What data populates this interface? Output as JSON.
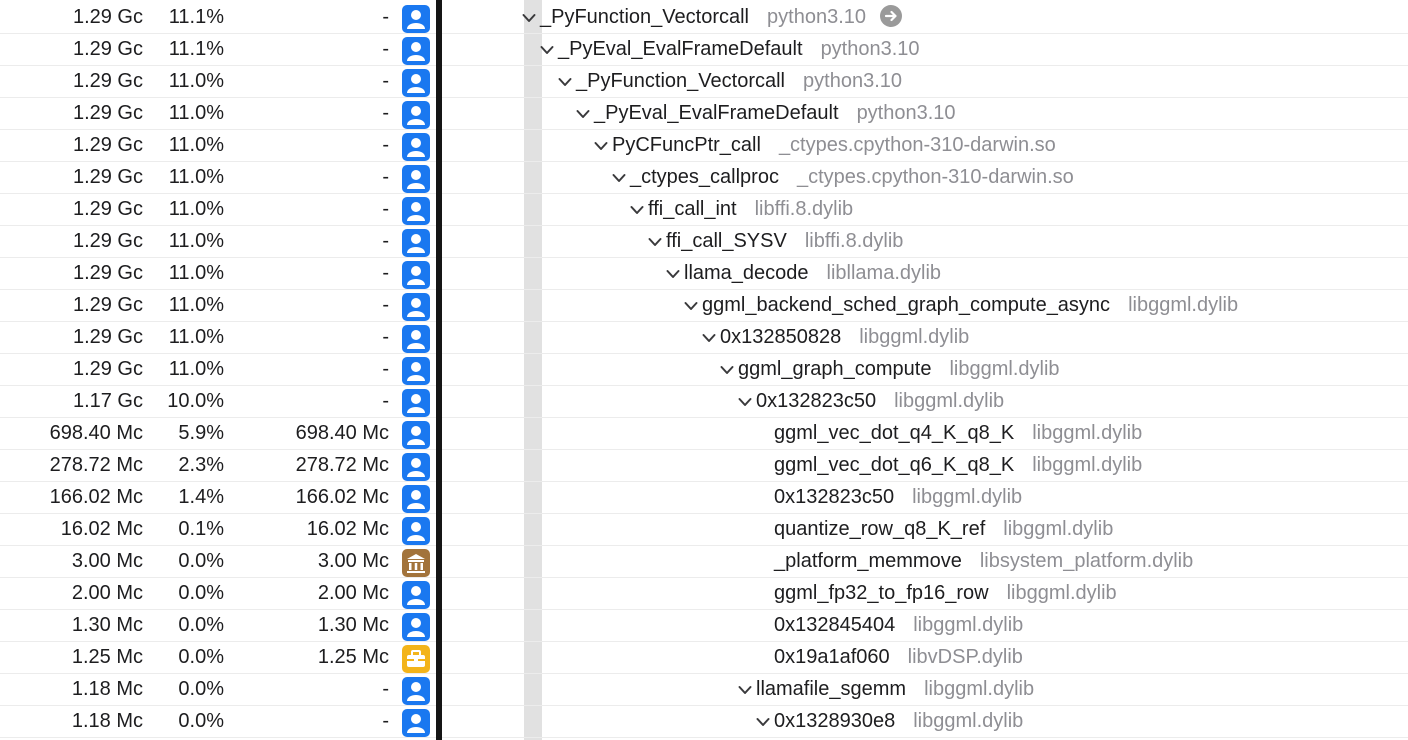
{
  "left_rows": [
    {
      "weight": "1.29 Gc",
      "percent": "11.1%",
      "self": "-",
      "icon": "user-icon"
    },
    {
      "weight": "1.29 Gc",
      "percent": "11.1%",
      "self": "-",
      "icon": "user-icon"
    },
    {
      "weight": "1.29 Gc",
      "percent": "11.0%",
      "self": "-",
      "icon": "user-icon"
    },
    {
      "weight": "1.29 Gc",
      "percent": "11.0%",
      "self": "-",
      "icon": "user-icon"
    },
    {
      "weight": "1.29 Gc",
      "percent": "11.0%",
      "self": "-",
      "icon": "user-icon"
    },
    {
      "weight": "1.29 Gc",
      "percent": "11.0%",
      "self": "-",
      "icon": "user-icon"
    },
    {
      "weight": "1.29 Gc",
      "percent": "11.0%",
      "self": "-",
      "icon": "user-icon"
    },
    {
      "weight": "1.29 Gc",
      "percent": "11.0%",
      "self": "-",
      "icon": "user-icon"
    },
    {
      "weight": "1.29 Gc",
      "percent": "11.0%",
      "self": "-",
      "icon": "user-icon"
    },
    {
      "weight": "1.29 Gc",
      "percent": "11.0%",
      "self": "-",
      "icon": "user-icon"
    },
    {
      "weight": "1.29 Gc",
      "percent": "11.0%",
      "self": "-",
      "icon": "user-icon"
    },
    {
      "weight": "1.29 Gc",
      "percent": "11.0%",
      "self": "-",
      "icon": "user-icon"
    },
    {
      "weight": "1.17 Gc",
      "percent": "10.0%",
      "self": "-",
      "icon": "user-icon"
    },
    {
      "weight": "698.40 Mc",
      "percent": "5.9%",
      "self": "698.40 Mc",
      "icon": "user-icon"
    },
    {
      "weight": "278.72 Mc",
      "percent": "2.3%",
      "self": "278.72 Mc",
      "icon": "user-icon"
    },
    {
      "weight": "166.02 Mc",
      "percent": "1.4%",
      "self": "166.02 Mc",
      "icon": "user-icon"
    },
    {
      "weight": "16.02 Mc",
      "percent": "0.1%",
      "self": "16.02 Mc",
      "icon": "user-icon"
    },
    {
      "weight": "3.00 Mc",
      "percent": "0.0%",
      "self": "3.00 Mc",
      "icon": "library-icon"
    },
    {
      "weight": "2.00 Mc",
      "percent": "0.0%",
      "self": "2.00 Mc",
      "icon": "user-icon"
    },
    {
      "weight": "1.30 Mc",
      "percent": "0.0%",
      "self": "1.30 Mc",
      "icon": "user-icon"
    },
    {
      "weight": "1.25 Mc",
      "percent": "0.0%",
      "self": "1.25 Mc",
      "icon": "toolbox-icon"
    },
    {
      "weight": "1.18 Mc",
      "percent": "0.0%",
      "self": "-",
      "icon": "user-icon"
    },
    {
      "weight": "1.18 Mc",
      "percent": "0.0%",
      "self": "-",
      "icon": "user-icon"
    }
  ],
  "tree_rows": [
    {
      "symbol": "_PyFunction_Vectorcall",
      "library": "python3.10",
      "expanded": true,
      "depth": 0,
      "focus_button": true
    },
    {
      "symbol": "_PyEval_EvalFrameDefault",
      "library": "python3.10",
      "expanded": true,
      "depth": 1
    },
    {
      "symbol": "_PyFunction_Vectorcall",
      "library": "python3.10",
      "expanded": true,
      "depth": 2
    },
    {
      "symbol": "_PyEval_EvalFrameDefault",
      "library": "python3.10",
      "expanded": true,
      "depth": 3
    },
    {
      "symbol": "PyCFuncPtr_call",
      "library": "_ctypes.cpython-310-darwin.so",
      "expanded": true,
      "depth": 4
    },
    {
      "symbol": "_ctypes_callproc",
      "library": "_ctypes.cpython-310-darwin.so",
      "expanded": true,
      "depth": 5
    },
    {
      "symbol": "ffi_call_int",
      "library": "libffi.8.dylib",
      "expanded": true,
      "depth": 6
    },
    {
      "symbol": "ffi_call_SYSV",
      "library": "libffi.8.dylib",
      "expanded": true,
      "depth": 7
    },
    {
      "symbol": "llama_decode",
      "library": "libllama.dylib",
      "expanded": true,
      "depth": 8
    },
    {
      "symbol": "ggml_backend_sched_graph_compute_async",
      "library": "libggml.dylib",
      "expanded": true,
      "depth": 9
    },
    {
      "symbol": "0x132850828",
      "library": "libggml.dylib",
      "expanded": true,
      "depth": 10
    },
    {
      "symbol": "ggml_graph_compute",
      "library": "libggml.dylib",
      "expanded": true,
      "depth": 11
    },
    {
      "symbol": "0x132823c50",
      "library": "libggml.dylib",
      "expanded": true,
      "depth": 12
    },
    {
      "symbol": "ggml_vec_dot_q4_K_q8_K",
      "library": "libggml.dylib",
      "expanded": false,
      "depth": 13
    },
    {
      "symbol": "ggml_vec_dot_q6_K_q8_K",
      "library": "libggml.dylib",
      "expanded": false,
      "depth": 13
    },
    {
      "symbol": "0x132823c50",
      "library": "libggml.dylib",
      "expanded": false,
      "depth": 13
    },
    {
      "symbol": "quantize_row_q8_K_ref",
      "library": "libggml.dylib",
      "expanded": false,
      "depth": 13
    },
    {
      "symbol": "_platform_memmove",
      "library": "libsystem_platform.dylib",
      "expanded": false,
      "depth": 13
    },
    {
      "symbol": "ggml_fp32_to_fp16_row",
      "library": "libggml.dylib",
      "expanded": false,
      "depth": 13
    },
    {
      "symbol": "0x132845404",
      "library": "libggml.dylib",
      "expanded": false,
      "depth": 13
    },
    {
      "symbol": "0x19a1af060",
      "library": "libvDSP.dylib",
      "expanded": false,
      "depth": 13
    },
    {
      "symbol": "llamafile_sgemm",
      "library": "libggml.dylib",
      "expanded": true,
      "depth": 12
    },
    {
      "symbol": "0x1328930e8",
      "library": "libggml.dylib",
      "expanded": true,
      "depth": 13
    }
  ],
  "colors": {
    "user": "#1a78f0",
    "library": "#a2733b",
    "toolbox": "#f3b41a",
    "divider": "#151515",
    "library_text": "#8e8e93"
  }
}
